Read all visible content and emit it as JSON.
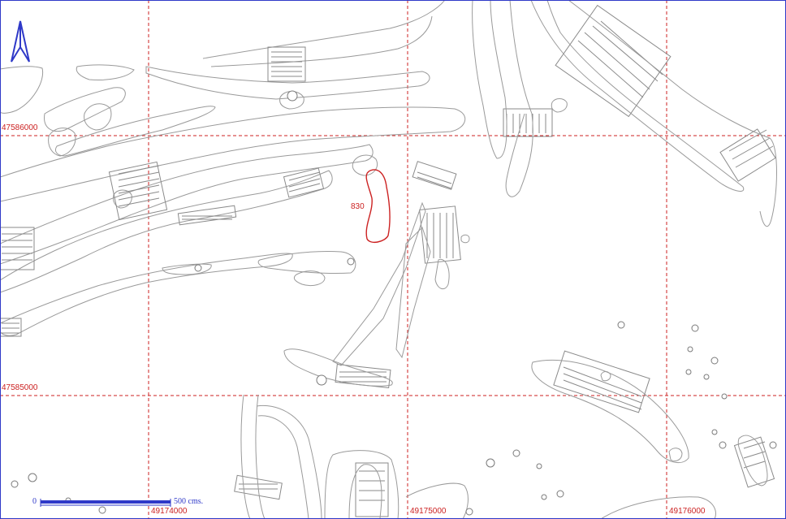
{
  "map": {
    "target_feature": {
      "label": "830",
      "color": "#cc2222"
    },
    "grid": {
      "line_color": "#cc2222",
      "northings": [
        "47586000",
        "47585000"
      ],
      "eastings": [
        "49174000",
        "49175000",
        "49176000"
      ]
    },
    "north_arrow": {
      "icon": "north-arrow-icon",
      "color": "#2f39c8"
    },
    "scale": {
      "zero_label": "0",
      "end_label": "500  cms.",
      "color": "#2f39c8"
    },
    "feature_color": "#9a9a9a"
  }
}
